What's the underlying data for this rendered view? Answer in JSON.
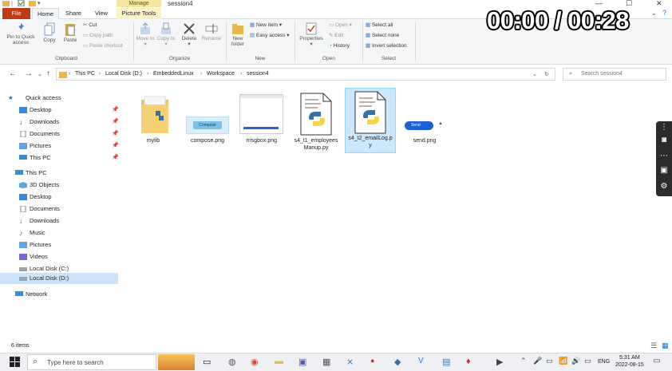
{
  "window": {
    "title": "session4",
    "manage_label": "Manage",
    "minimize": "—",
    "maximize": "☐",
    "close": "✕"
  },
  "timer": "00:00 / 00:28",
  "tabs": {
    "file": "File",
    "home": "Home",
    "share": "Share",
    "view": "View",
    "picture_tools": "Picture Tools"
  },
  "ribbon": {
    "pin_quick": "Pin to Quick access",
    "copy": "Copy",
    "paste": "Paste",
    "cut": "Cut",
    "copy_path": "Copy path",
    "paste_shortcut": "Paste shortcut",
    "clipboard": "Clipboard",
    "move_to": "Move to",
    "copy_to": "Copy to",
    "delete": "Delete",
    "rename": "Rename",
    "organize": "Organize",
    "new_folder": "New folder",
    "new_item": "New item",
    "easy_access": "Easy access",
    "new": "New",
    "properties": "Properties",
    "open": "Open",
    "edit": "Edit",
    "history": "History",
    "open_group": "Open",
    "select_all": "Select all",
    "select_none": "Select none",
    "invert_selection": "Invert selection",
    "select": "Select"
  },
  "address": {
    "crumbs": [
      "This PC",
      "Local Disk (D:)",
      "EmbeddedLinux",
      "Workspace",
      "session4"
    ],
    "search_placeholder": "Search session4"
  },
  "nav": {
    "quick_access": "Quick access",
    "desktop": "Desktop",
    "downloads": "Downloads",
    "documents": "Documents",
    "pictures": "Pictures",
    "this_pc_qa": "This PC",
    "this_pc": "This PC",
    "objects3d": "3D Objects",
    "desktop2": "Desktop",
    "documents2": "Documents",
    "downloads2": "Downloads",
    "music": "Music",
    "pictures2": "Pictures",
    "videos": "Videos",
    "local_c": "Local Disk (C:)",
    "local_d": "Local Disk (D:)",
    "network": "Network"
  },
  "files": [
    {
      "name": "mylib",
      "type": "folder"
    },
    {
      "name": "compose.png",
      "type": "image",
      "thumb_text": "Compose"
    },
    {
      "name": "msgbox.png",
      "type": "image"
    },
    {
      "name": "s4_t1_employeesManup.py",
      "line1": "s4_t1_employees",
      "line2": "Manup.py",
      "type": "python"
    },
    {
      "name": "s4_t2_emailLog.py",
      "line1": "s4_t2_emailLog.p",
      "line2": "y",
      "type": "python"
    },
    {
      "name": "send.png",
      "type": "image",
      "thumb_text": "Send"
    }
  ],
  "status": {
    "items": "6 items"
  },
  "taskbar": {
    "search_placeholder": "Type here to search",
    "time": "5:31 AM",
    "date": "2022-08-15",
    "lang": "ENG"
  },
  "colors": {
    "file_tab": "#c13a16",
    "selection": "#cce8ff",
    "manage": "#f5e7a0",
    "python_blue": "#3572a5",
    "python_yellow": "#f7d346"
  }
}
